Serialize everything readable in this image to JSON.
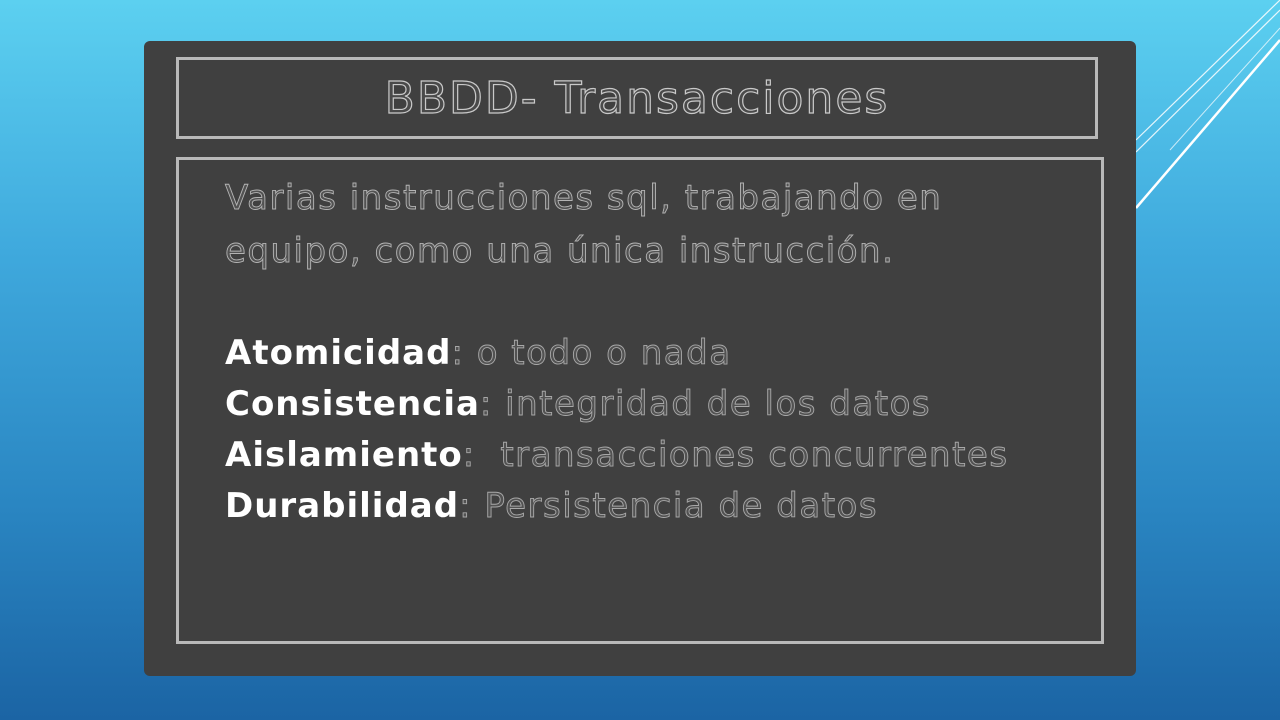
{
  "slide": {
    "title": "BBDD- Transacciones",
    "intro": "Varias instrucciones sql, trabajando en equipo, como una única instrucción.",
    "properties": [
      {
        "term": "Atomicidad",
        "description": ": o todo o nada"
      },
      {
        "term": "Consistencia",
        "description": ": integridad de los datos"
      },
      {
        "term": "Aislamiento",
        "description": ":  transacciones concurrentes"
      },
      {
        "term": "Durabilidad",
        "description": ": Persistencia de datos"
      }
    ]
  },
  "theme": {
    "background_top": "#5cd0f0",
    "background_bottom": "#1b64a4",
    "board": "#404040",
    "frame": "#b9b9b9",
    "accent_text": "#ffffff"
  }
}
